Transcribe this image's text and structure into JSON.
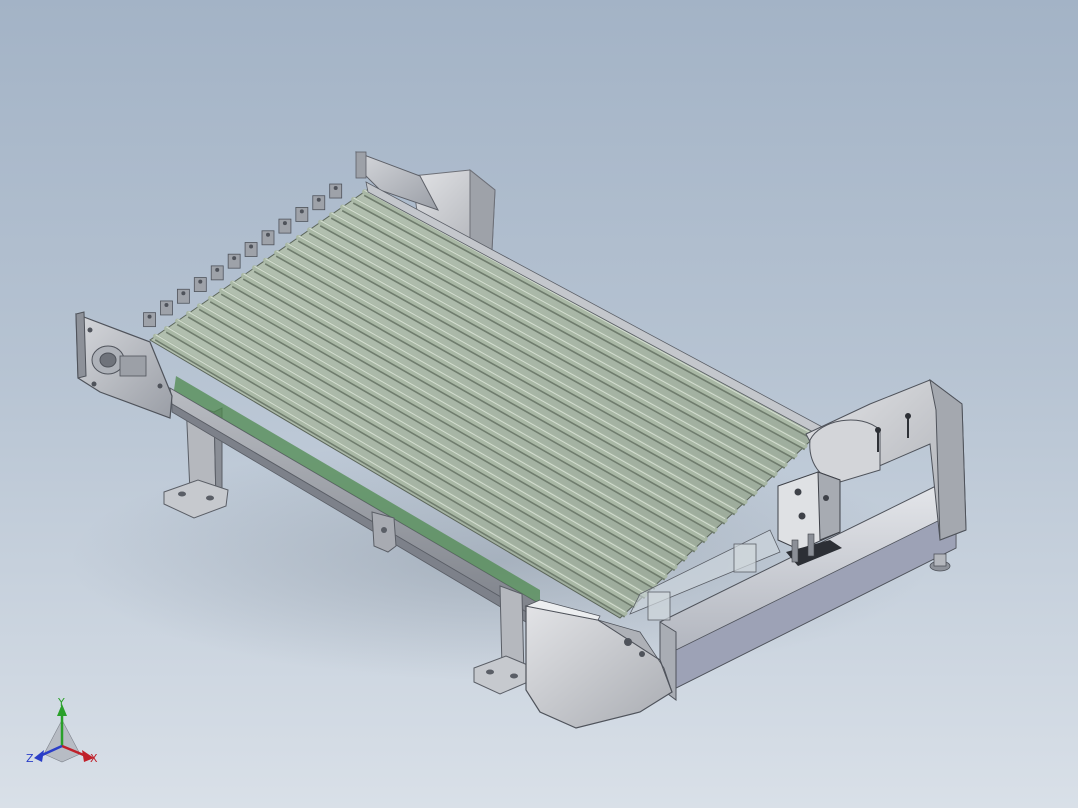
{
  "viewport": {
    "background_top": "#a3b3c6",
    "background_bottom": "#d9e0e8"
  },
  "model": {
    "roller_color": "#a9b8a5",
    "frame_color": "#c9ccd0",
    "belt_color": "#4f8a4f"
  },
  "triad": {
    "x_label": "X",
    "y_label": "Y",
    "z_label": "Z",
    "x_color": "#c0202a",
    "y_color": "#2aa02a",
    "z_color": "#2a3ec8"
  }
}
